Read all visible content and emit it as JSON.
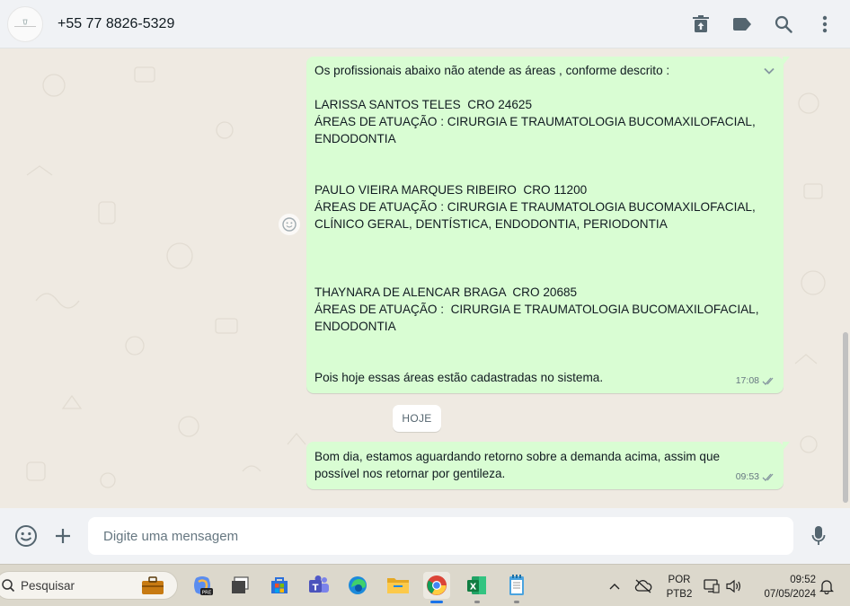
{
  "header": {
    "contact": "+55 77 8826-5329",
    "icons": [
      "delete-icon",
      "label-icon",
      "search-icon",
      "more-icon"
    ]
  },
  "messages": [
    {
      "lines": [
        "Os profissionais abaixo não atende as áreas , conforme descrito :",
        "",
        "LARISSA SANTOS TELES  CRO 24625",
        "ÁREAS DE ATUAÇÃO : CIRURGIA E TRAUMATOLOGIA BUCOMAXILOFACIAL,",
        "ENDODONTIA",
        "",
        "",
        "PAULO VIEIRA MARQUES RIBEIRO  CRO 11200",
        "ÁREAS DE ATUAÇÃO : CIRURGIA E TRAUMATOLOGIA BUCOMAXILOFACIAL,",
        "CLÍNICO GERAL, DENTÍSTICA, ENDODONTIA, PERIODONTIA",
        "",
        "",
        "",
        "THAYNARA DE ALENCAR BRAGA  CRO 20685",
        "ÁREAS DE ATUAÇÃO :  CIRURGIA E TRAUMATOLOGIA BUCOMAXILOFACIAL,",
        "ENDODONTIA",
        "",
        "",
        "Pois hoje essas áreas estão cadastradas no sistema."
      ],
      "time": "17:08"
    },
    {
      "text": "Bom dia, estamos aguardando retorno sobre a demanda acima, assim que possível nos retornar por gentileza.",
      "time": "09:53"
    }
  ],
  "date_chip": "HOJE",
  "composer": {
    "placeholder": "Digite uma mensagem"
  },
  "taskbar": {
    "search_label": "Pesquisar",
    "lang_top": "POR",
    "lang_bottom": "PTB2",
    "time": "09:52",
    "date": "07/05/2024"
  },
  "colors": {
    "bubble_out": "#d9fdd3",
    "chat_bg": "#efeae2",
    "read_tick": "#53bdeb"
  }
}
